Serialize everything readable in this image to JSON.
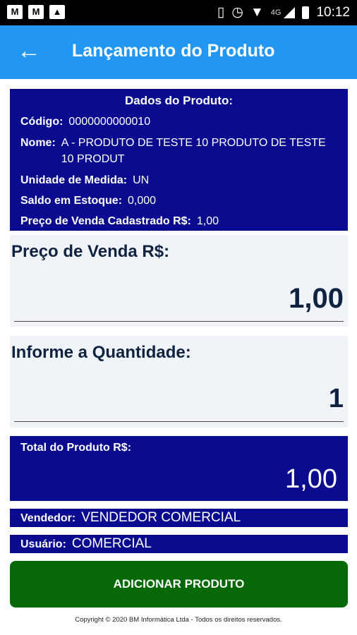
{
  "status_bar": {
    "network": "4G",
    "time": "10:12"
  },
  "app_bar": {
    "title": "Lançamento do Produto"
  },
  "product": {
    "heading": "Dados do Produto:",
    "codigo_label": "Código:",
    "codigo": "0000000000010",
    "nome_label": "Nome:",
    "nome": "A - PRODUTO DE TESTE 10 PRODUTO DE TESTE 10 PRODUT",
    "unidade_label": "Unidade de Medida:",
    "unidade": "UN",
    "saldo_label": "Saldo em Estoque:",
    "saldo": "0,000",
    "preco_cad_label": "Preço de Venda Cadastrado R$:",
    "preco_cad": "1,00"
  },
  "price_input": {
    "label": "Preço de Venda R$:",
    "value": "1,00"
  },
  "qty_input": {
    "label": "Informe a Quantidade:",
    "value": "1"
  },
  "total": {
    "label": "Total do Produto R$:",
    "value": "1,00"
  },
  "seller": {
    "label": "Vendedor:",
    "value": "VENDEDOR COMERCIAL"
  },
  "user": {
    "label": "Usuário:",
    "value": "COMERCIAL"
  },
  "add_button": {
    "label": "ADICIONAR PRODUTO"
  },
  "footer": {
    "copyright": "Copyright © 2020 BM Informática Ltda - Todos os direitos reservados."
  },
  "colors": {
    "appbar": "#2196f3",
    "card": "#0b0b8f",
    "button": "#076807",
    "panel": "#f0f4f8"
  }
}
